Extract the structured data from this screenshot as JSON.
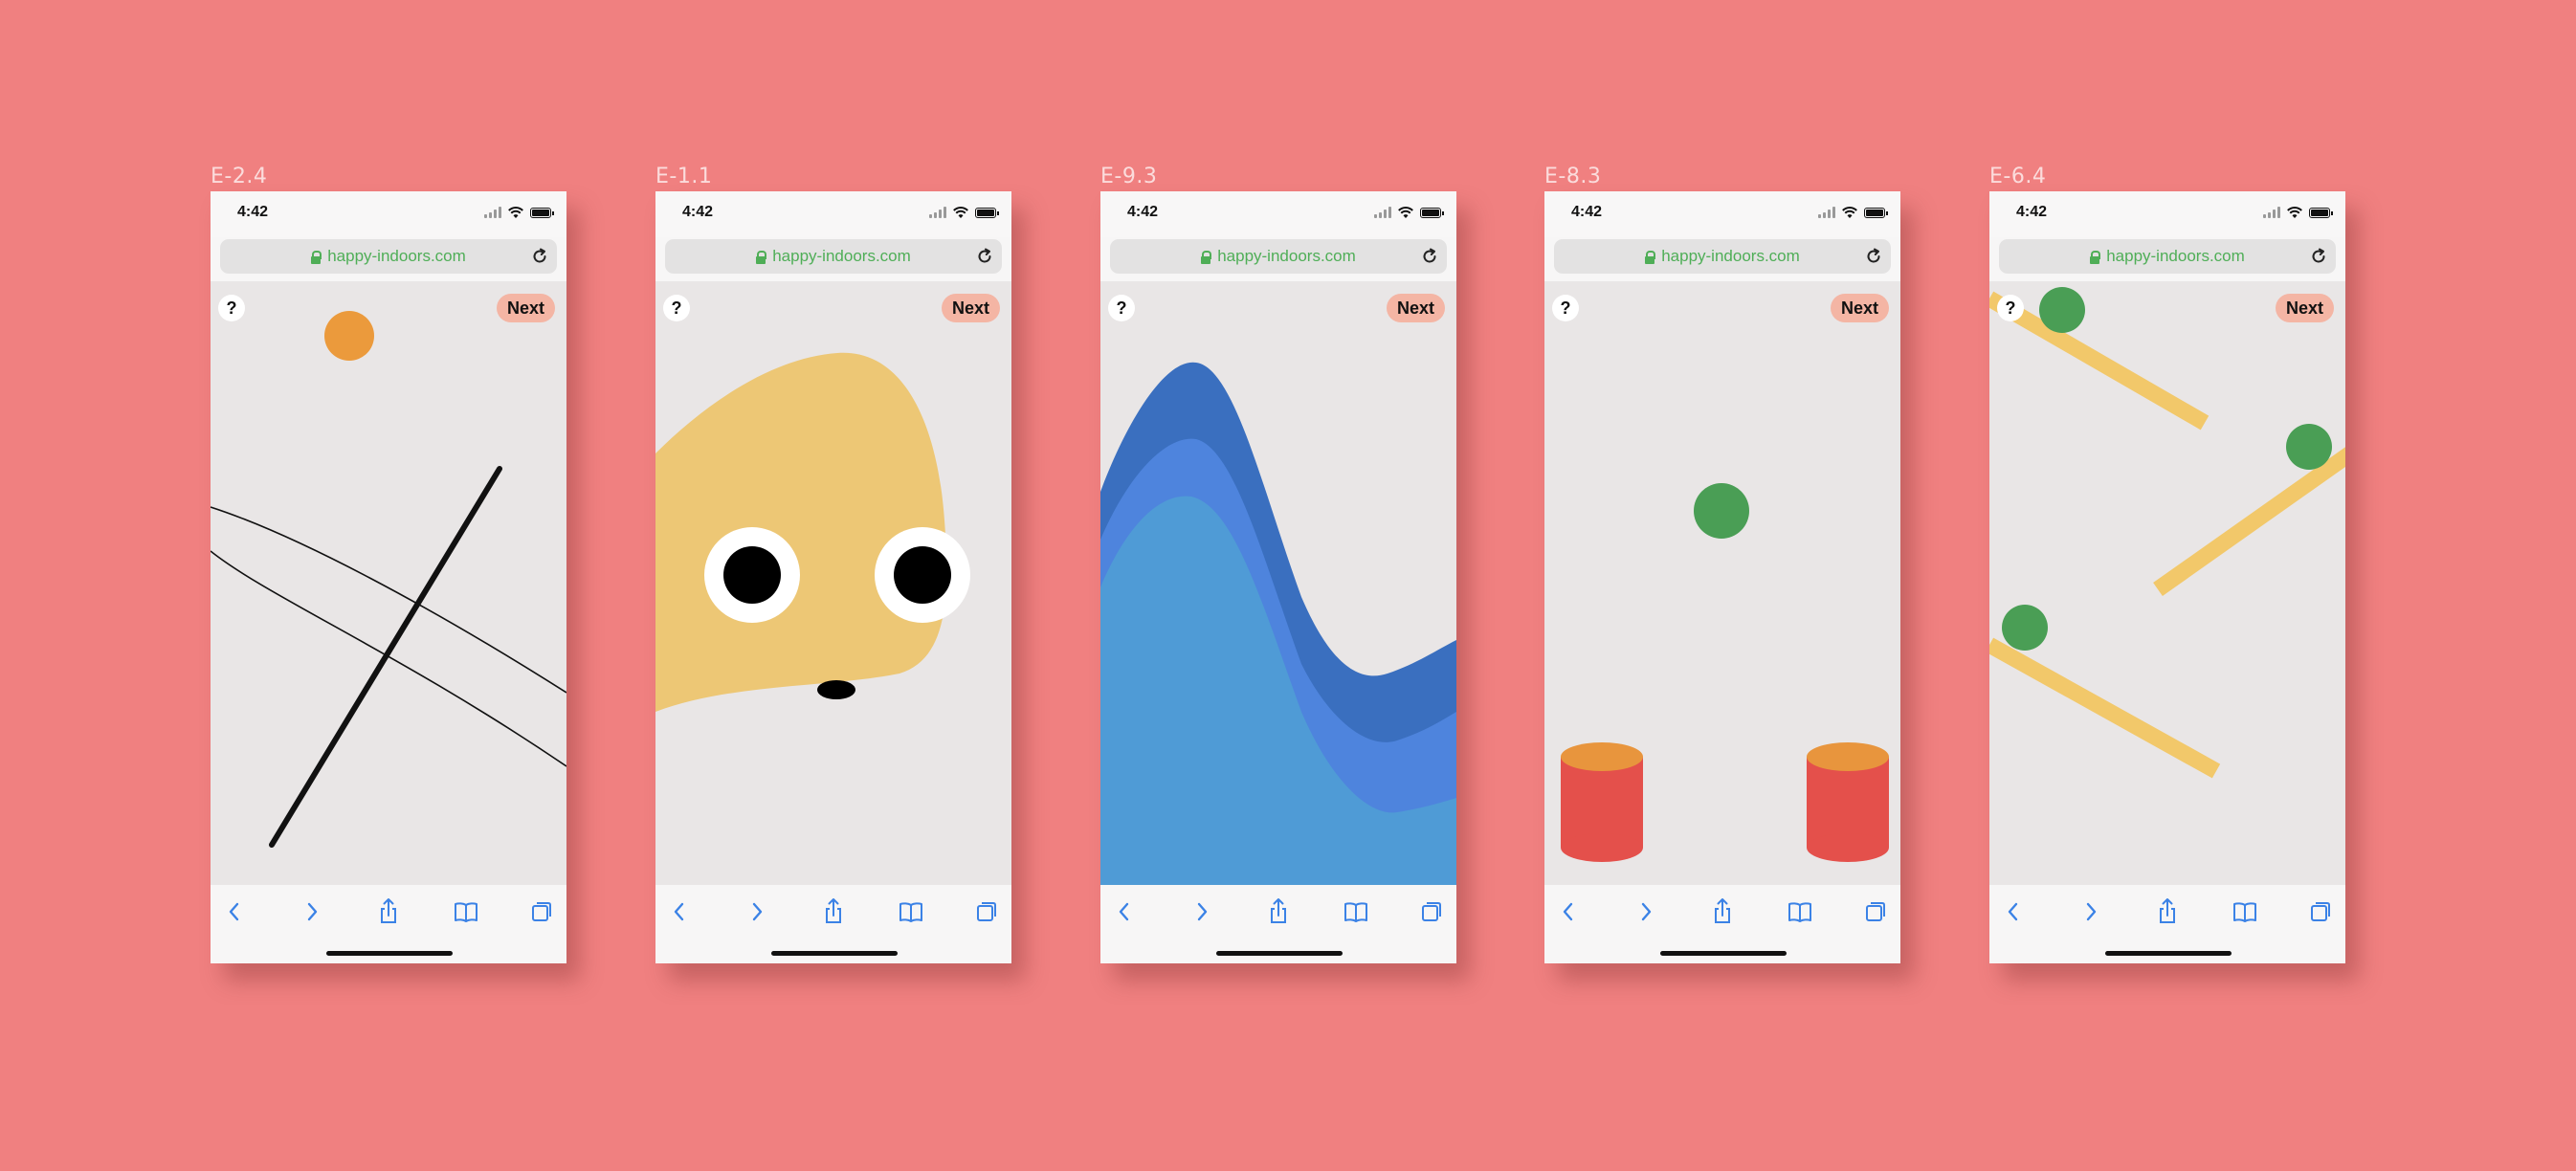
{
  "background_color": "#f08080",
  "phones": [
    {
      "label": "E-2.4",
      "time": "4:42",
      "url": "happy-indoors.com",
      "help_label": "?",
      "next_label": "Next"
    },
    {
      "label": "E-1.1",
      "time": "4:42",
      "url": "happy-indoors.com",
      "help_label": "?",
      "next_label": "Next"
    },
    {
      "label": "E-9.3",
      "time": "4:42",
      "url": "happy-indoors.com",
      "help_label": "?",
      "next_label": "Next"
    },
    {
      "label": "E-8.3",
      "time": "4:42",
      "url": "happy-indoors.com",
      "help_label": "?",
      "next_label": "Next"
    },
    {
      "label": "E-6.4",
      "time": "4:42",
      "url": "happy-indoors.com",
      "help_label": "?",
      "next_label": "Next"
    }
  ],
  "toolbar_icons": [
    "back-icon",
    "forward-icon",
    "share-icon",
    "bookmarks-icon",
    "tabs-icon"
  ],
  "colors": {
    "url_green": "#4fae57",
    "accent_blue": "#3b82e6",
    "orange_ball": "#eb9a3c",
    "face_yellow": "#edc775",
    "wave_dark": "#3a6fbf",
    "wave_mid": "#4e84dd",
    "wave_light": "#4f9bd6",
    "ball_green": "#4a9e55",
    "cylinder_red": "#e4504b",
    "cylinder_top": "#e8953d",
    "ramp_yellow": "#f2c86a"
  }
}
